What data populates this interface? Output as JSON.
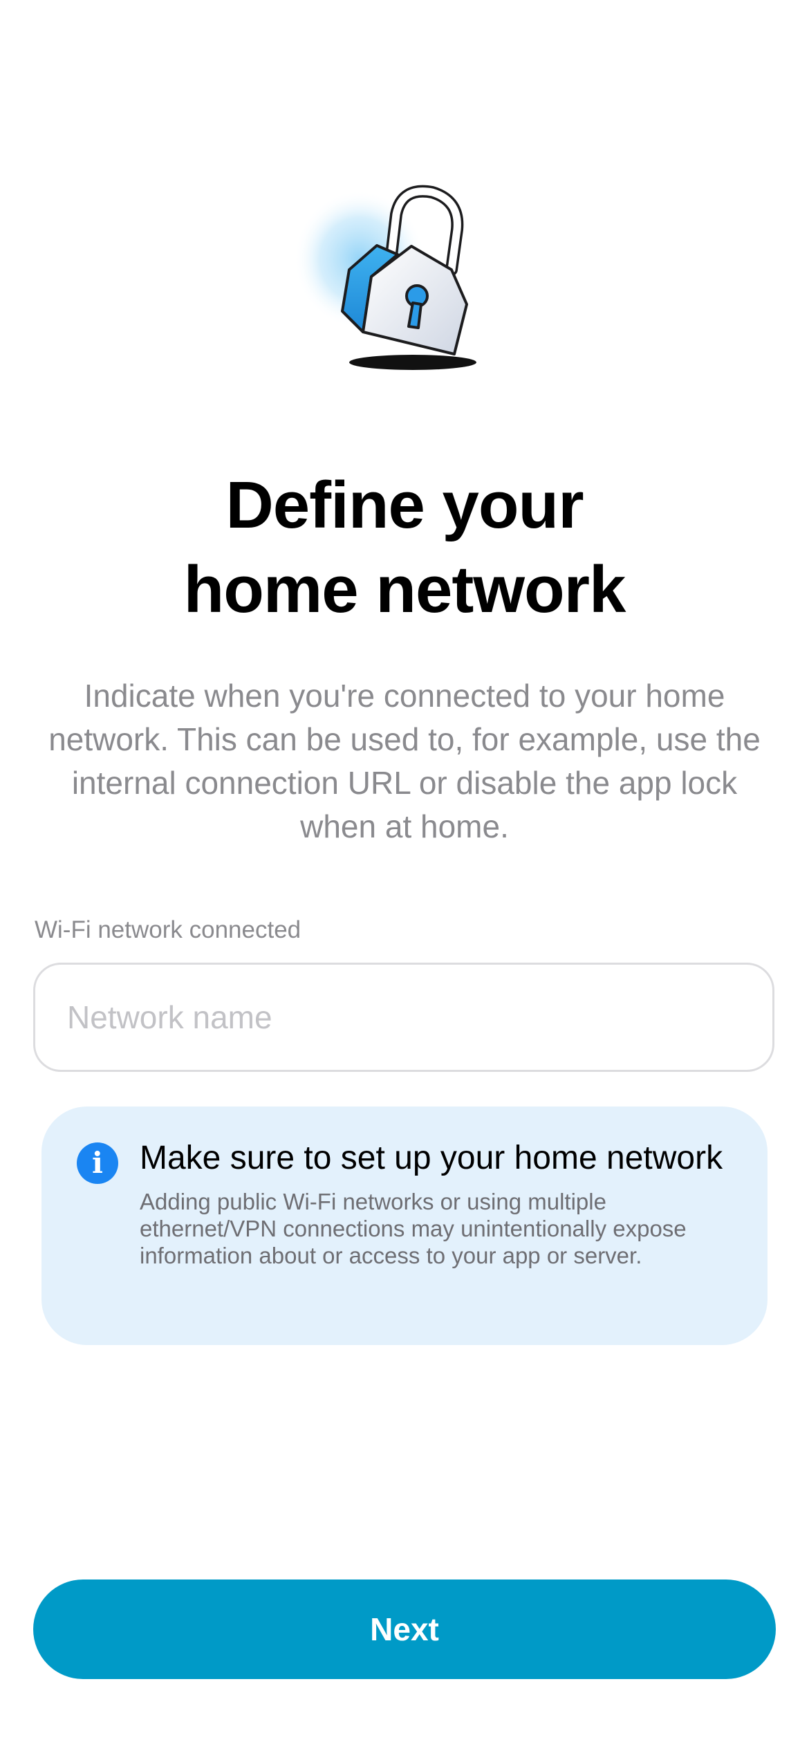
{
  "hero": {
    "icon": "padlock-icon"
  },
  "title": {
    "line1": "Define your",
    "line2": "home network"
  },
  "description": "Indicate when you're connected to your home network. This can be used to, for example, use the internal connection URL or disable the app lock when at home.",
  "wifi_field": {
    "label": "Wi-Fi network connected",
    "value": "",
    "placeholder": "Network name"
  },
  "info": {
    "icon": "info-icon",
    "title": "Make sure to set up your home network",
    "body": "Adding public Wi-Fi networks or using multiple ethernet/VPN connections may unintentionally expose information about or access to your app or server."
  },
  "next_button": {
    "label": "Next"
  },
  "colors": {
    "accent": "#009ac7",
    "info_background": "#e3f1fc",
    "info_icon": "#1a85f2",
    "secondary_text": "#8a8a8e"
  }
}
